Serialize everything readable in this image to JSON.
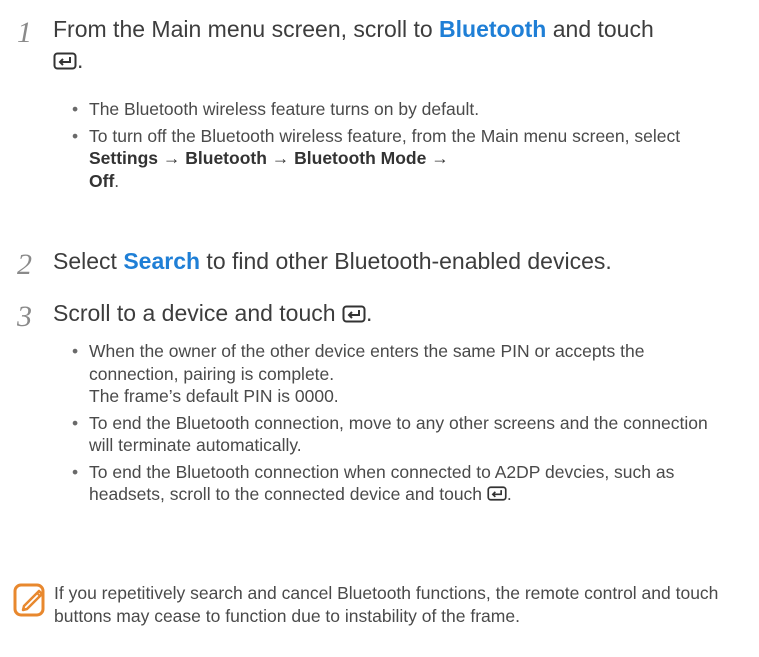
{
  "steps": [
    {
      "number": "1",
      "text_parts": [
        "From the Main menu screen, scroll to ",
        "Bluetooth",
        " and touch",
        "."
      ],
      "bullets": [
        {
          "text": "The Bluetooth wireless feature turns on by default."
        },
        {
          "parts": [
            "To turn off the Bluetooth wireless feature, from the Main menu screen, select ",
            "Settings → Bluetooth → Bluetooth Mode →",
            "Off",
            "."
          ]
        }
      ]
    },
    {
      "number": "2",
      "text_parts": [
        "Select ",
        "Search",
        " to find other Bluetooth-enabled devices."
      ]
    },
    {
      "number": "3",
      "text_parts": [
        "Scroll to a device and touch",
        "."
      ],
      "bullets": [
        {
          "line1": "When the owner of the other device enters the same PIN or accepts the connection, pairing is complete.",
          "line2": "The frame’s default PIN is 0000."
        },
        {
          "text": "To end the Bluetooth connection, move to any other screens and the connection will terminate automatically."
        },
        {
          "parts": [
            "To end the Bluetooth connection when connected to A2DP devcies, such as headsets, scroll to the connected device and touch",
            "."
          ]
        }
      ]
    }
  ],
  "note": {
    "icon": "note-pencil-icon",
    "text": "If you repetitively search and cancel Bluetooth functions, the remote control and touch buttons may cease to function due to instability of the frame."
  },
  "colors": {
    "highlight": "#1f7fd6",
    "note_icon": "#e8882e"
  }
}
